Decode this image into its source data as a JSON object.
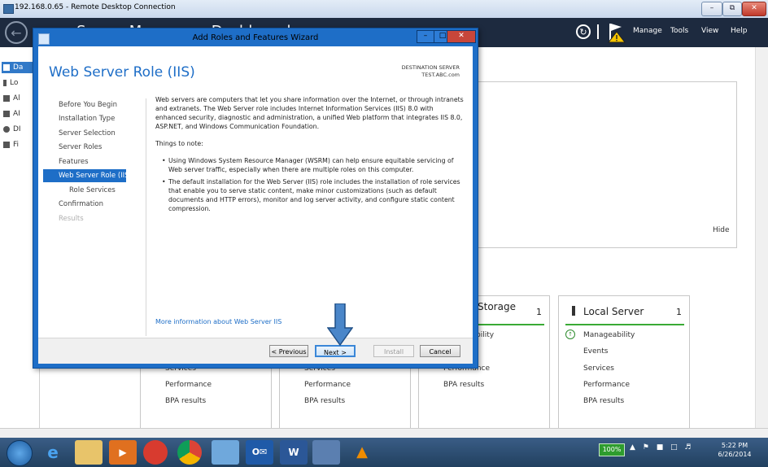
{
  "rdp": {
    "title": "192.168.0.65 - Remote Desktop Connection",
    "minimize": "–",
    "restore": "⧉",
    "close": "✕"
  },
  "server_manager": {
    "title": "Server Manager • Dashboard",
    "menu": [
      "Manage",
      "Tools",
      "View",
      "Help"
    ],
    "sidebar": [
      {
        "label": "Da",
        "icon": "dashboard-icon"
      },
      {
        "label": "Lo",
        "icon": "local-server-icon"
      },
      {
        "label": "Al",
        "icon": "all-servers-icon"
      },
      {
        "label": "AI",
        "icon": "ad-icon"
      },
      {
        "label": "DI",
        "icon": "dns-icon"
      },
      {
        "label": "Fi",
        "icon": "file-storage-icon"
      }
    ],
    "hide_label": "Hide",
    "tiles": [
      {
        "title": "",
        "count": "",
        "rows": [
          "Services",
          "Performance",
          "BPA results"
        ]
      },
      {
        "title": "",
        "count": "",
        "rows": [
          "Services",
          "Performance",
          "BPA results"
        ]
      },
      {
        "title": "Storage",
        "count": "1",
        "rows": [
          "bility",
          "Performance",
          "BPA results"
        ]
      },
      {
        "title": "Local Server",
        "count": "1",
        "rows": [
          "Manageability",
          "Events",
          "Services",
          "Performance",
          "BPA results"
        ]
      }
    ]
  },
  "wizard": {
    "title": "Add Roles and Features Wizard",
    "heading": "Web Server Role (IIS)",
    "destination_label": "DESTINATION SERVER",
    "destination_server": "TEST.ABC.com",
    "nav": [
      {
        "label": "Before You Begin",
        "state": "normal"
      },
      {
        "label": "Installation Type",
        "state": "normal"
      },
      {
        "label": "Server Selection",
        "state": "normal"
      },
      {
        "label": "Server Roles",
        "state": "normal"
      },
      {
        "label": "Features",
        "state": "normal"
      },
      {
        "label": "Web Server Role (IIS)",
        "state": "active"
      },
      {
        "label": "Role Services",
        "state": "sub"
      },
      {
        "label": "Confirmation",
        "state": "normal"
      },
      {
        "label": "Results",
        "state": "disabled"
      }
    ],
    "intro": "Web servers are computers that let you share information over the Internet, or through intranets and extranets. The Web Server role includes Internet Information Services (IIS) 8.0 with enhanced security, diagnostic and administration, a unified Web platform that integrates IIS 8.0, ASP.NET, and Windows Communication Foundation.",
    "things_to_note": "Things to note:",
    "bullets": [
      "Using Windows System Resource Manager (WSRM) can help ensure equitable servicing of Web server traffic, especially when there are multiple roles on this computer.",
      "The default installation for the Web Server (IIS) role includes the installation of role services that enable you to serve static content, make minor customizations (such as default documents and HTTP errors), monitor and log server activity, and configure static content compression."
    ],
    "more_info": "More information about Web Server IIS",
    "buttons": {
      "previous": "< Previous",
      "next": "Next >",
      "install": "Install",
      "cancel": "Cancel"
    }
  },
  "taskbar": {
    "battery": "100%",
    "time": "5:22 PM",
    "date": "6/26/2014"
  },
  "colors": {
    "accent": "#1e6ec7",
    "header_bg": "#1d2a3f",
    "tile_green": "#3aaa35"
  }
}
